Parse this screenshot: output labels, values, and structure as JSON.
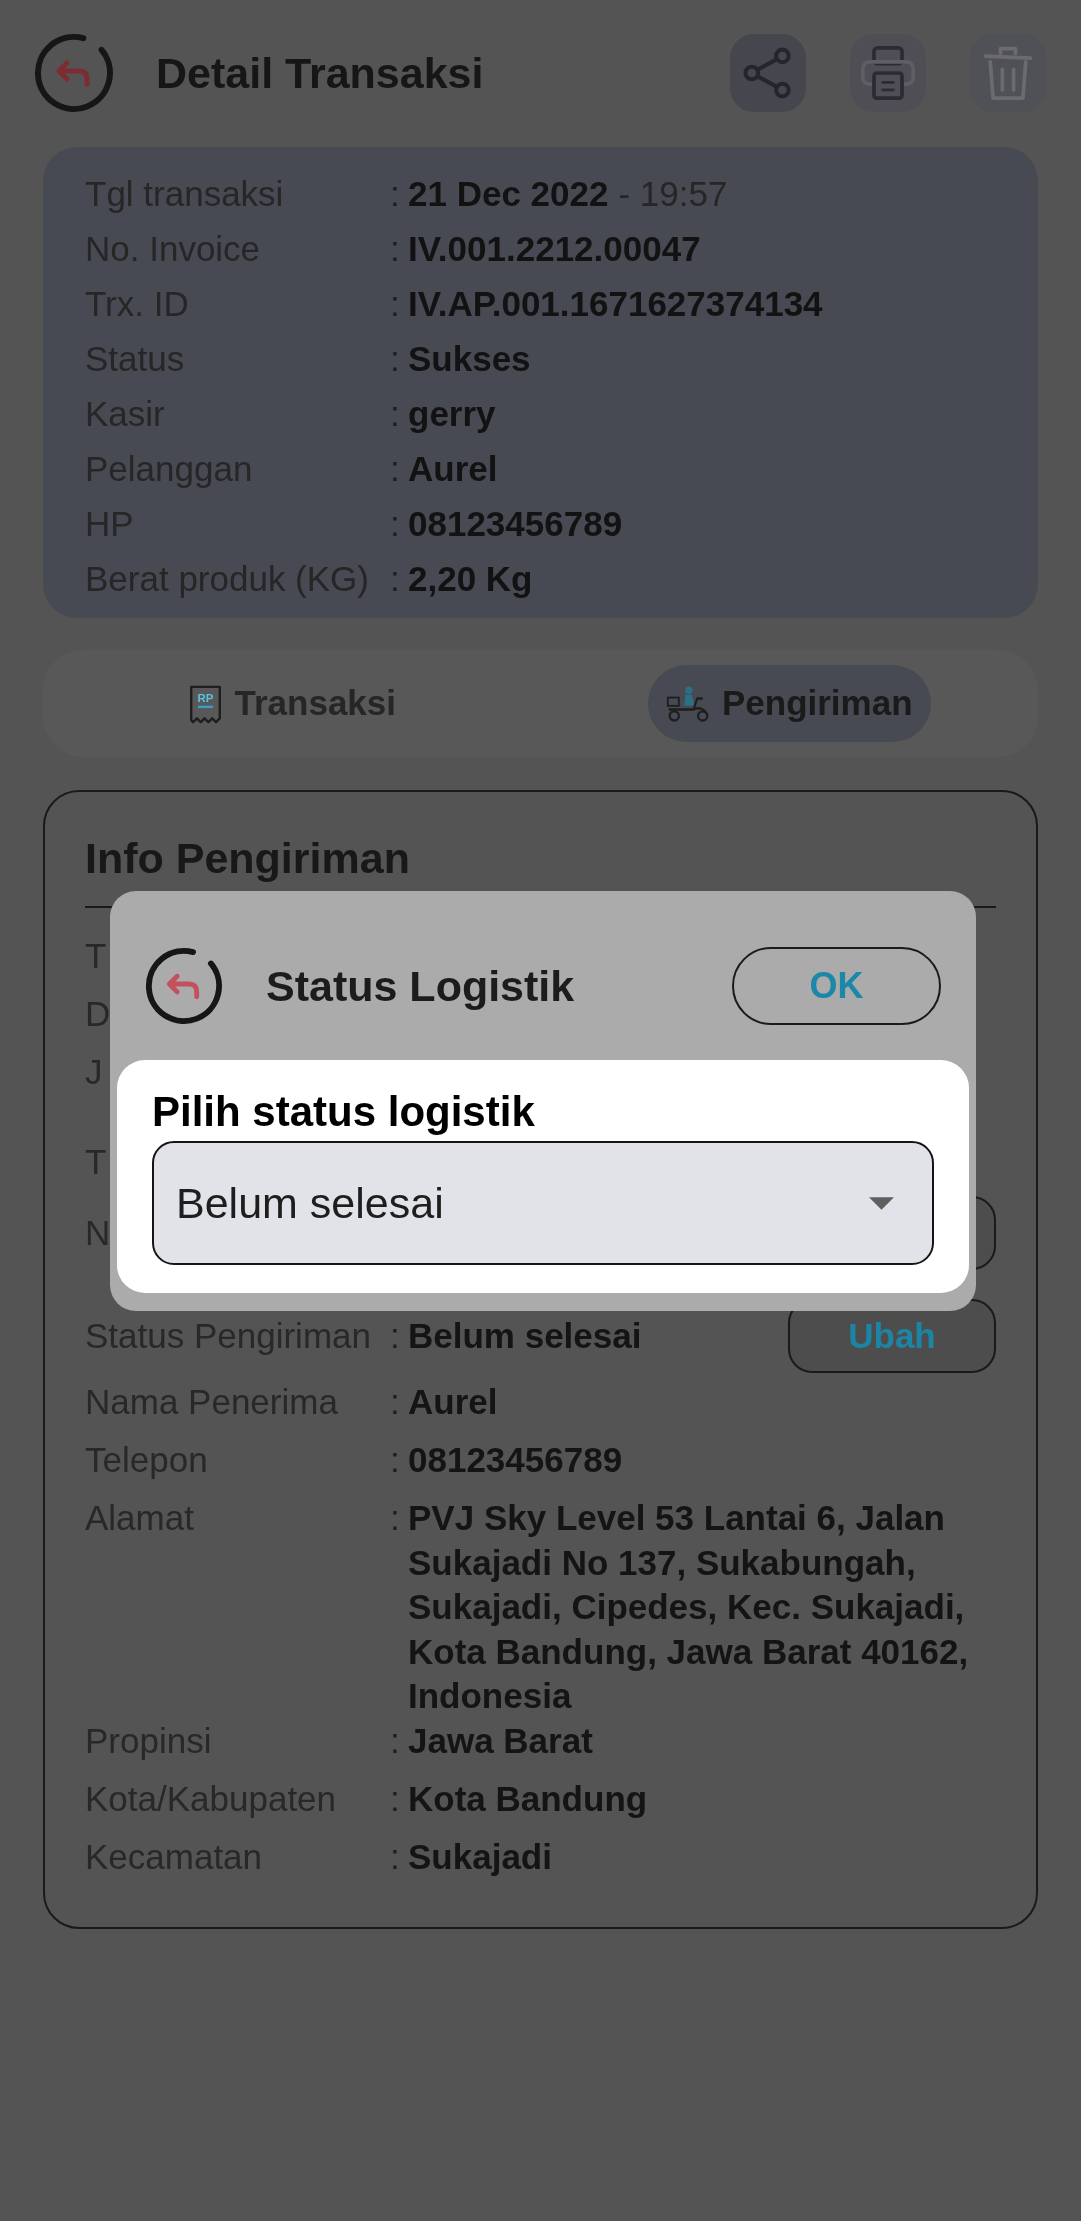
{
  "header": {
    "title": "Detail Transaksi"
  },
  "summary": [
    {
      "label": "Tgl transaksi",
      "separator": ":",
      "value": "21 Dec 2022",
      "time": "- 19:57"
    },
    {
      "label": "No. Invoice",
      "separator": ":",
      "value": "IV.001.2212.00047"
    },
    {
      "label": "Trx. ID",
      "separator": ":",
      "value": "IV.AP.001.1671627374134"
    },
    {
      "label": "Status",
      "separator": ":",
      "value": "Sukses"
    },
    {
      "label": "Kasir",
      "separator": ":",
      "value": "gerry"
    },
    {
      "label": "Pelanggan",
      "separator": ":",
      "value": "Aurel"
    },
    {
      "label": "HP",
      "separator": ":",
      "value": "08123456789"
    },
    {
      "label": "Berat produk (KG)",
      "separator": ":",
      "value": "2,20 Kg"
    }
  ],
  "tabs": [
    {
      "label": "Transaksi",
      "icon_text": "RP",
      "selected": false
    },
    {
      "label": "Pengiriman",
      "selected": true
    }
  ],
  "shipping": {
    "title": "Info Pengiriman",
    "rows": [
      {
        "kind": "covered",
        "label": "T"
      },
      {
        "kind": "covered",
        "label": "D"
      },
      {
        "kind": "covered",
        "label": "J"
      },
      {
        "kind": "covered",
        "label": "T"
      },
      {
        "kind": "covered_action",
        "label": "N"
      },
      {
        "kind": "action",
        "label": "Status Pengiriman",
        "separator": ":",
        "value": "Belum selesai",
        "button": "Ubah"
      },
      {
        "kind": "field",
        "label": "Nama Penerima",
        "separator": ":",
        "value": "Aurel"
      },
      {
        "kind": "field",
        "label": "Telepon",
        "separator": ":",
        "value": "08123456789"
      },
      {
        "kind": "field",
        "label": "Alamat",
        "separator": ":",
        "value": "PVJ Sky Level 53 Lantai 6, Jalan Sukajadi No 137, Sukabungah, Sukajadi, Cipedes, Kec. Sukajadi, Kota Bandung, Jawa Barat 40162, Indonesia"
      },
      {
        "kind": "field",
        "label": "Propinsi",
        "separator": ":",
        "value": "Jawa Barat"
      },
      {
        "kind": "field",
        "label": "Kota/Kabupaten",
        "separator": ":",
        "value": "Kota Bandung"
      },
      {
        "kind": "field",
        "label": "Kecamatan",
        "separator": ":",
        "value": "Sukajadi"
      }
    ]
  },
  "dialog": {
    "title": "Status Logistik",
    "ok": "OK",
    "field_label": "Pilih status logistik",
    "value": "Belum selesai"
  }
}
